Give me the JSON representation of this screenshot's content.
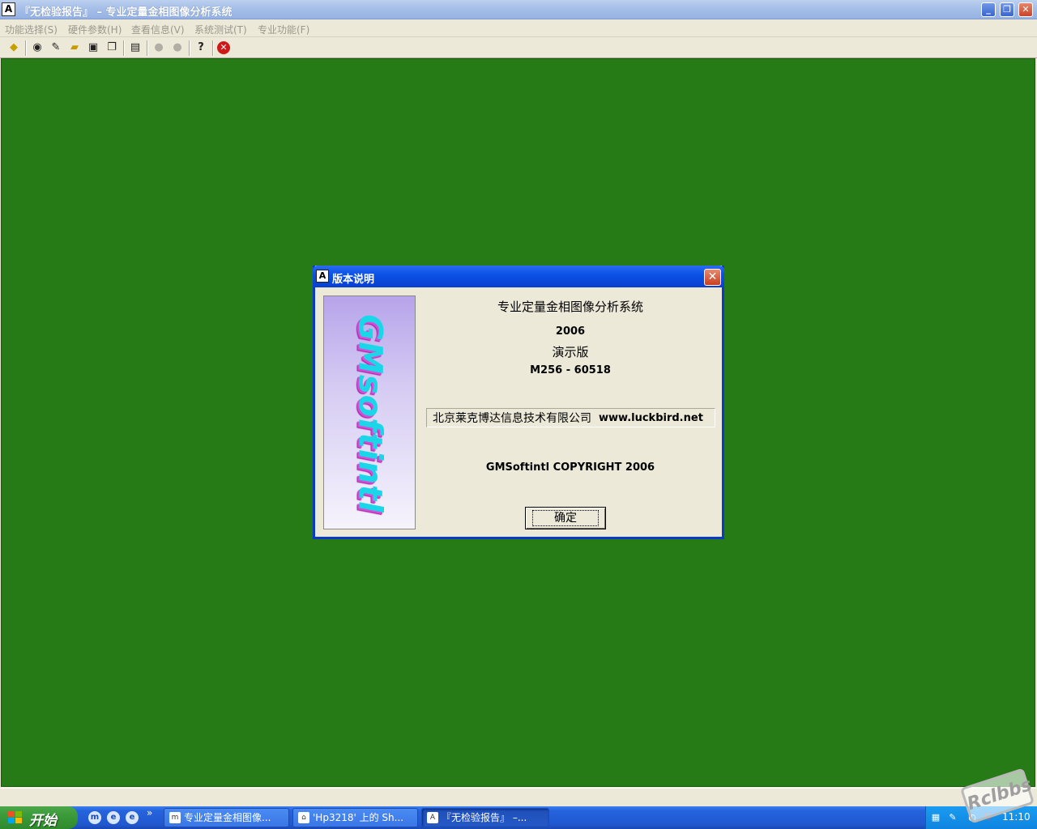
{
  "window": {
    "title": "『无检验报告』 – 专业定量金相图像分析系统",
    "controls": {
      "minimize": "_",
      "restore": "❐",
      "close": "✕"
    }
  },
  "menu": [
    "功能选择(S)",
    "硬件参数(H)",
    "查看信息(V)",
    "系统测试(T)",
    "专业功能(F)"
  ],
  "toolbar": {
    "icons": [
      "run-diamond-icon",
      "record-disc-icon",
      "edit-note-icon",
      "open-folder-icon",
      "save-disk-icon",
      "copy-windows-icon",
      "properties-icon",
      "zoom-in-icon",
      "zoom-out-icon",
      "help-icon",
      "exit-icon"
    ]
  },
  "dialog": {
    "title": "版本说明",
    "banner": "GMsoftintl",
    "product": "专业定量金相图像分析系统",
    "year": "2006",
    "edition": "演示版",
    "code": "M256 - 60518",
    "company": "北京莱克博达信息技术有限公司",
    "url": "www.luckbird.net",
    "copyright": "GMSoftintl COPYRIGHT 2006",
    "ok": "确定"
  },
  "taskbar": {
    "start": "开始",
    "more": "»",
    "tasks": [
      {
        "label": "专业定量金相图像...",
        "active": false
      },
      {
        "label": "'Hp3218' 上的 Sh...",
        "active": false
      },
      {
        "label": "『无检验报告』 –...",
        "active": true
      }
    ],
    "clock": "11:10"
  },
  "watermark": "Rclbbs",
  "colors": {
    "desktop": "#267b17",
    "dialog_border": "#0a3bc8",
    "taskbar": "#2158d0"
  }
}
